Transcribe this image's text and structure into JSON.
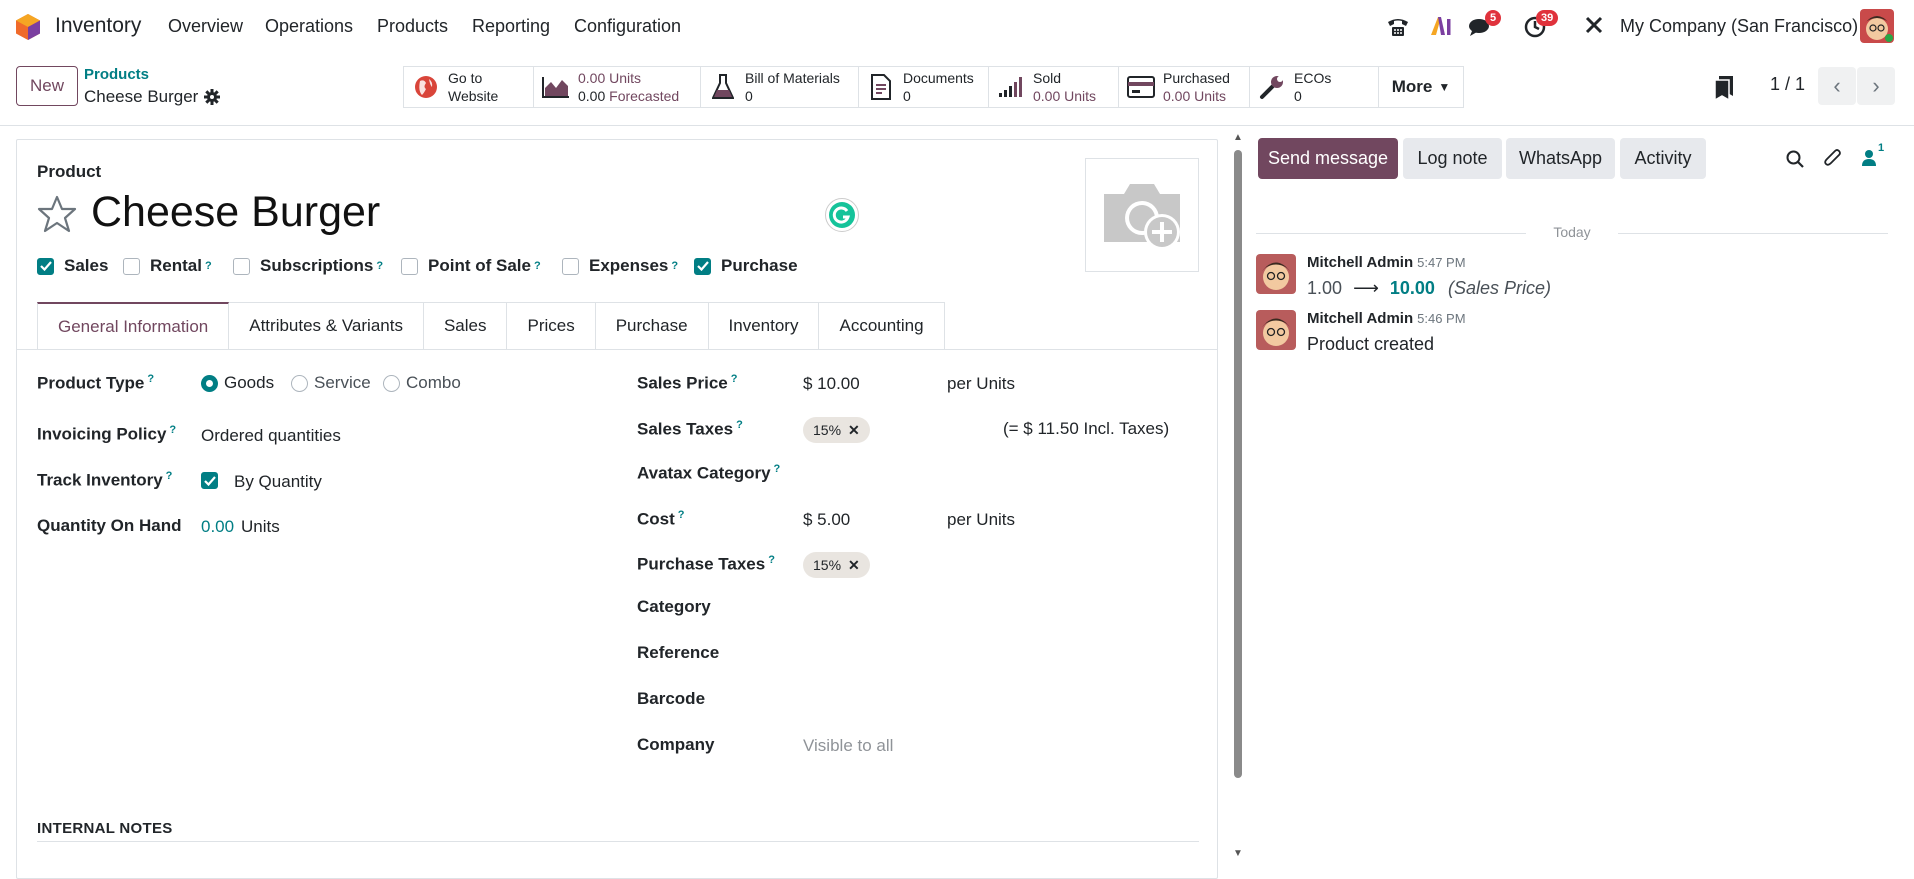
{
  "app": {
    "name": "Inventory"
  },
  "menu": [
    "Overview",
    "Operations",
    "Products",
    "Reporting",
    "Configuration"
  ],
  "systray": {
    "chat_count": "5",
    "activity_count": "39",
    "company": "My Company (San Francisco)"
  },
  "control": {
    "new_label": "New",
    "breadcrumb_parent": "Products",
    "breadcrumb_current": "Cheese Burger",
    "smart_buttons": [
      {
        "l1": "Go to",
        "l2": "Website",
        "icon": "globe-icon"
      },
      {
        "l1a": "0.00",
        "l1b": "Units",
        "l2a": "0.00",
        "l2b": "Forecasted",
        "icon": "area-chart-icon"
      },
      {
        "l1": "Bill of Materials",
        "l2": "0",
        "icon": "flask-icon"
      },
      {
        "l1": "Documents",
        "l2": "0",
        "icon": "document-icon"
      },
      {
        "l1": "Sold",
        "l2": "0.00 Units",
        "icon": "signal-icon"
      },
      {
        "l1": "Purchased",
        "l2": "0.00 Units",
        "icon": "credit-card-icon"
      },
      {
        "l1": "ECOs",
        "l2": "0",
        "icon": "wrench-icon"
      }
    ],
    "more_label": "More",
    "pager": "1 / 1"
  },
  "form": {
    "product_label": "Product",
    "name": "Cheese Burger",
    "checkboxes": [
      {
        "label": "Sales",
        "checked": true,
        "help": false
      },
      {
        "label": "Rental",
        "checked": false,
        "help": true
      },
      {
        "label": "Subscriptions",
        "checked": false,
        "help": true
      },
      {
        "label": "Point of Sale",
        "checked": false,
        "help": true
      },
      {
        "label": "Expenses",
        "checked": false,
        "help": true
      },
      {
        "label": "Purchase",
        "checked": true,
        "help": false
      }
    ],
    "tabs": [
      "General Information",
      "Attributes & Variants",
      "Sales",
      "Prices",
      "Purchase",
      "Inventory",
      "Accounting"
    ],
    "left": {
      "product_type_label": "Product Type",
      "type_options": [
        "Goods",
        "Service",
        "Combo"
      ],
      "type_selected": "Goods",
      "invoicing_label": "Invoicing Policy",
      "invoicing_value": "Ordered quantities",
      "track_label": "Track Inventory",
      "track_value": "By Quantity",
      "qoh_label": "Quantity On Hand",
      "qoh_value": "0.00",
      "qoh_unit": "Units"
    },
    "right": {
      "sales_price_label": "Sales Price",
      "sales_price_value": "$ 10.00",
      "sales_price_unit": "per Units",
      "sales_taxes_label": "Sales Taxes",
      "sales_tax_tag": "15%",
      "sales_tax_incl": "(= $ 11.50 Incl. Taxes)",
      "avatax_label": "Avatax Category",
      "cost_label": "Cost",
      "cost_value": "$ 5.00",
      "cost_unit": "per Units",
      "purchase_taxes_label": "Purchase Taxes",
      "purchase_tax_tag": "15%",
      "category_label": "Category",
      "reference_label": "Reference",
      "barcode_label": "Barcode",
      "company_label": "Company",
      "company_placeholder": "Visible to all"
    },
    "notes_heading": "INTERNAL NOTES"
  },
  "chatter": {
    "send_message": "Send message",
    "log_note": "Log note",
    "whatsapp": "WhatsApp",
    "activity": "Activity",
    "followers": "1",
    "today": "Today",
    "messages": [
      {
        "author": "Mitchell Admin",
        "time": "5:47 PM",
        "old": "1.00",
        "new": "10.00",
        "field": "(Sales Price)"
      },
      {
        "author": "Mitchell Admin",
        "time": "5:46 PM",
        "body": "Product created"
      }
    ]
  },
  "colors": {
    "brand": "#71475f",
    "accent": "#017e84",
    "badge": "#e0323c"
  }
}
